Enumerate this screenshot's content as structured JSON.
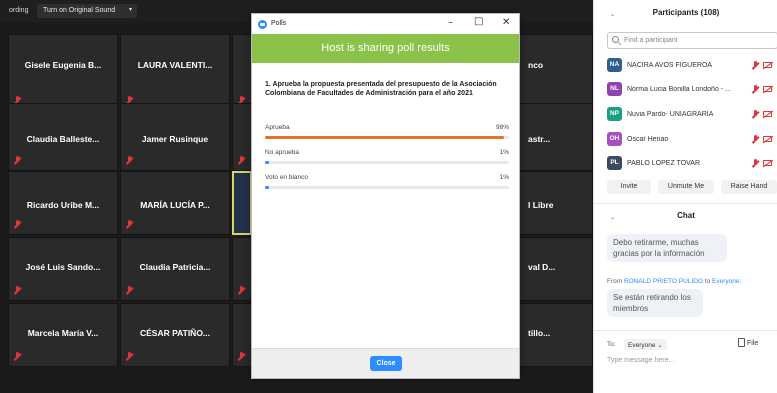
{
  "topbar": {
    "recording_label": "ording",
    "original_sound_label": "Turn on Original Sound"
  },
  "tiles": [
    {
      "name": "Gisele Eugenia B..."
    },
    {
      "name": "LAURA VALENTI..."
    },
    {
      "name": "nco"
    },
    {
      "name": "Claudia Balleste..."
    },
    {
      "name": "Jamer Rusinque"
    },
    {
      "name": "astr..."
    },
    {
      "name": "Ricardo Uribe M..."
    },
    {
      "name": "MARÍA LUCÍA P..."
    },
    {
      "name": "l Libre"
    },
    {
      "name": "José Luis Sando..."
    },
    {
      "name": "Claudia Patricia..."
    },
    {
      "name": "val D..."
    },
    {
      "name": "Marcela María V..."
    },
    {
      "name": "CÉSAR PATIÑO..."
    },
    {
      "name": "tillo..."
    }
  ],
  "poll": {
    "window_title": "Polls",
    "banner": "Host is sharing poll results",
    "question": "1. Aprueba la propuesta presentada del presupuesto de la Asociación Colombiana de Facultades de Administración para el año 2021",
    "options": [
      {
        "label": "Aprueba",
        "percent": "98%",
        "value": 98,
        "color": "#e8702a"
      },
      {
        "label": "No aprueba",
        "percent": "1%",
        "value": 1,
        "color": "#2d8cff"
      },
      {
        "label": "Voto en blanco",
        "percent": "1%",
        "value": 1,
        "color": "#2d8cff"
      }
    ],
    "close_label": "Close"
  },
  "participants": {
    "title": "Participants (108)",
    "search_placeholder": "Find a participant",
    "list": [
      {
        "initials": "NA",
        "name": "NACIRA AVOS FIGUEROA",
        "color": "#2f5f8a"
      },
      {
        "initials": "NL",
        "name": "Norma Lucia Bonilla Londoño - ...",
        "color": "#8e44ad"
      },
      {
        "initials": "NP",
        "name": "Nuvia Pardo- UNIAGRARIA",
        "color": "#1aa084"
      },
      {
        "initials": "OH",
        "name": "Oscar Henao",
        "color": "#a84fc2"
      },
      {
        "initials": "PL",
        "name": "PABLO LOPEZ TOVAR",
        "color": "#3c4b5e"
      }
    ],
    "invite_label": "Invite",
    "unmute_label": "Unmute Me",
    "raise_hand_label": "Raise Hand"
  },
  "chat": {
    "title": "Chat",
    "message1": "Debo retirarme, muchas gracias por la información",
    "from_prefix": "From",
    "from_name": "RONALD PRIETO PULIDO",
    "to_word": "to",
    "to_name": "Everyone:",
    "message2": "Se están retirando los miembros",
    "to_label": "To:",
    "to_value": "Everyone",
    "file_label": "File",
    "input_placeholder": "Type message here..."
  }
}
